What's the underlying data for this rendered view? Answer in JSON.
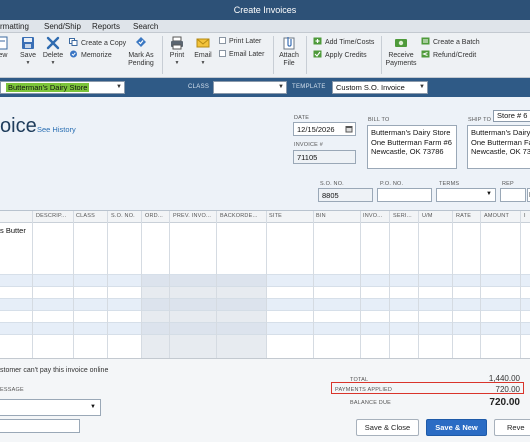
{
  "window": {
    "title": "Create Invoices"
  },
  "menu": {
    "items": [
      "rmatting",
      "Send/Ship",
      "Reports",
      "Search"
    ]
  },
  "toolbar": {
    "new_label": "ew",
    "save_label": "Save",
    "delete_label": "Delete",
    "create_copy_label": "Create a Copy",
    "memorize_label": "Memorize",
    "mark_pending_line1": "Mark As",
    "mark_pending_line2": "Pending",
    "print_label": "Print",
    "email_label": "Email",
    "print_later_label": "Print Later",
    "email_later_label": "Email Later",
    "attach_line1": "Attach",
    "attach_line2": "File",
    "add_time_costs_label": "Add Time/Costs",
    "apply_credits_label": "Apply Credits",
    "receive_payments_line1": "Receive",
    "receive_payments_line2": "Payments",
    "create_batch_label": "Create a Batch",
    "refund_credit_label": "Refund/Credit"
  },
  "band": {
    "customer_value": "Butterman's Dairy Store",
    "class_label": "CLASS",
    "class_value": "",
    "template_label": "TEMPLATE",
    "template_value": "Custom S.O. Invoice"
  },
  "form": {
    "title": "oice",
    "see_history": "See History",
    "date_label": "DATE",
    "date_value": "12/15/2026",
    "invoice_no_label": "INVOICE #",
    "invoice_no_value": "71105",
    "bill_to_label": "BILL TO",
    "bill_to_lines": [
      "Butterman's Dairy Store",
      "One Butterman Farm #6",
      "Newcastle, OK 73786"
    ],
    "ship_to_label": "SHIP TO",
    "ship_to_select": "Store # 6",
    "ship_to_lines": [
      "Butterman's Dairy S",
      "One Butterman Fa",
      "Newcastle, OK 73"
    ],
    "so_no_label": "S.O. NO.",
    "so_no_value": "8805",
    "po_no_label": "P.O. NO.",
    "po_no_value": "",
    "terms_label": "TERMS",
    "terms_value": "",
    "rep_label": "REP",
    "rep_value": "",
    "extra_label": "E"
  },
  "table": {
    "headers": [
      "DESCRIP...",
      "CLASS",
      "S.O. NO.",
      "ORD...",
      "PREV. INVO...",
      "BACKORDE...",
      "SITE",
      "BIN",
      "INVO...",
      "SERI...",
      "U/M",
      "RATE",
      "AMOUNT",
      "I"
    ],
    "first_row_item": "s Butter"
  },
  "footer": {
    "online_pay_text": "stomer can't pay this invoice online",
    "message_label": "ESSAGE",
    "total_label": "TOTAL",
    "total_value": "1,440.00",
    "payments_applied_label": "PAYMENTS APPLIED",
    "payments_applied_value": "720.00",
    "balance_due_label": "BALANCE DUE",
    "balance_due_value": "720.00",
    "save_close_label": "Save & Close",
    "save_new_label": "Save & New",
    "revert_label": "Reve"
  },
  "colors": {
    "title_bar": "#2d5177",
    "band": "#2f5a86",
    "customer_highlight": "#7cc43a",
    "primary_button": "#2b6cc4",
    "highlight_border": "#d9342b"
  }
}
